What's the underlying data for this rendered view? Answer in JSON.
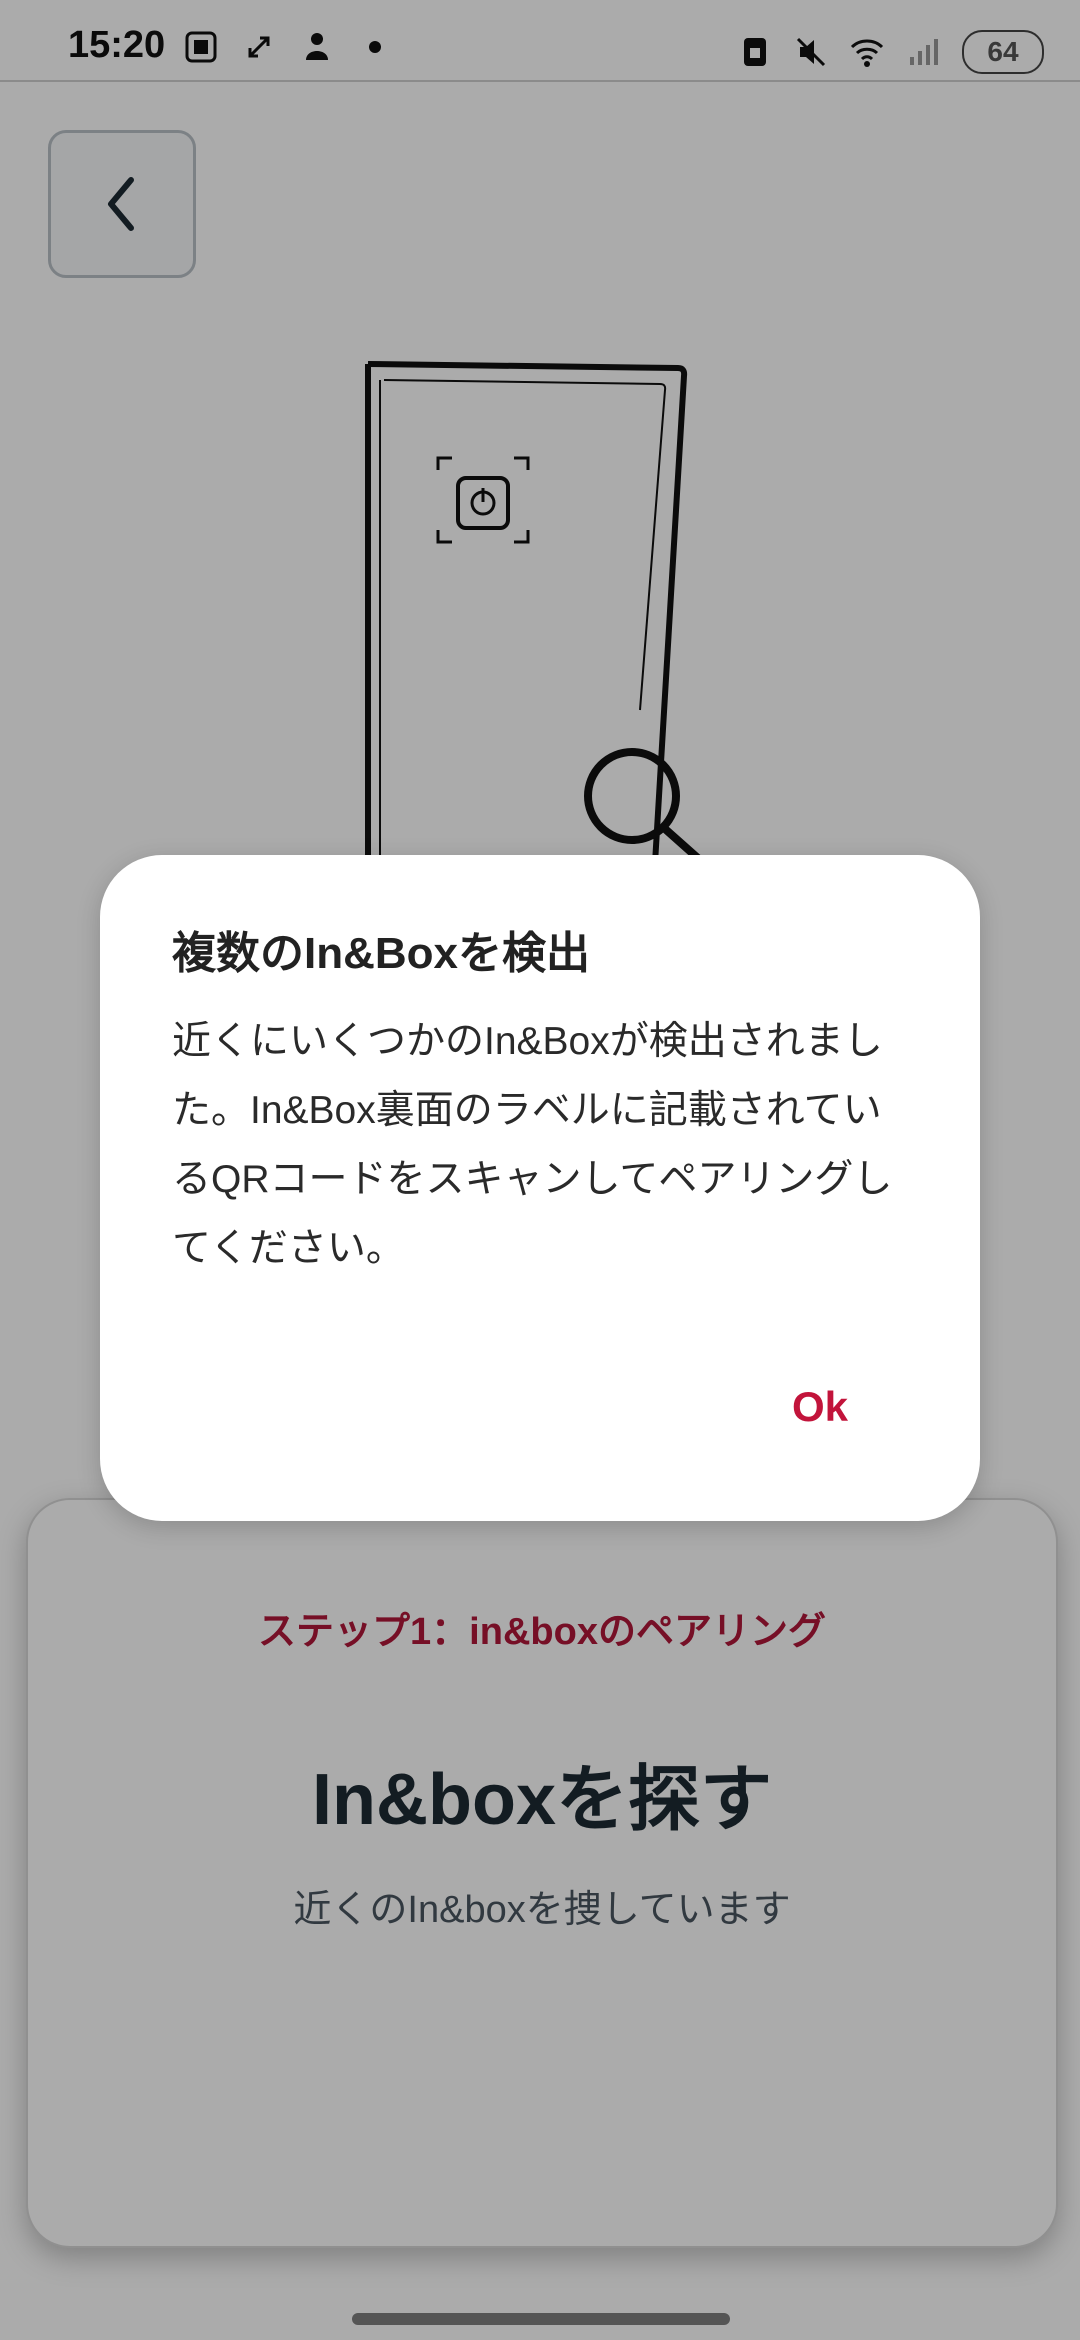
{
  "status_bar": {
    "time": "15:20",
    "battery": "64",
    "left_icons": [
      "screen-capture-icon",
      "expand-arrows-icon",
      "silhouette-icon",
      "dot-icon"
    ],
    "right_icons": [
      "sim-icon",
      "mute-icon",
      "wifi-icon",
      "signal-icon"
    ]
  },
  "back_button": {
    "icon": "chevron-left-icon"
  },
  "card": {
    "step_label": "ステップ1：in&boxのペアリング",
    "title": "In&boxを探す",
    "subtitle": "近くのIn&boxを捜しています"
  },
  "dialog": {
    "title": "複数のIn&Boxを検出",
    "body": "近くにいくつかのIn&Boxが検出されました。In&Box裏面のラベルに記載されているQRコードをスキャンしてペアリングしてください。",
    "ok_label": "Ok"
  },
  "colors": {
    "accent": "#c2143b",
    "scrim": "rgba(0,0,0,0.33)",
    "title_dark": "#1d2a34"
  }
}
